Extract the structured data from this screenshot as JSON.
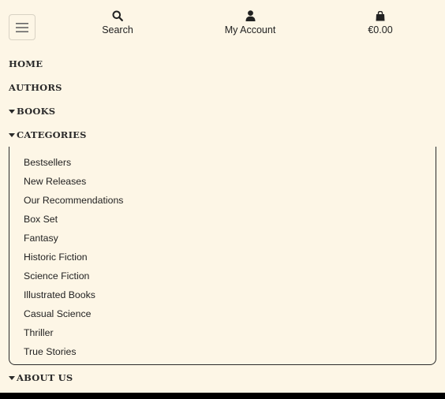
{
  "header": {
    "search_label": "Search",
    "account_label": "My Account",
    "cart_total": "€0.00"
  },
  "nav": {
    "home": "HOME",
    "authors": "AUTHORS",
    "books": "BOOKS",
    "categories": "CATEGORIES",
    "about_us": "ABOUT US"
  },
  "categories": {
    "items": [
      "Bestsellers",
      "New Releases",
      "Our Recommendations",
      "Box Set",
      "Fantasy",
      "Historic Fiction",
      "Science Fiction",
      "Illustrated Books",
      "Casual Science",
      "Thriller",
      "True Stories"
    ]
  },
  "colors": {
    "background": "#fdf6e6",
    "text": "#222222",
    "border": "#2a2a2a"
  }
}
